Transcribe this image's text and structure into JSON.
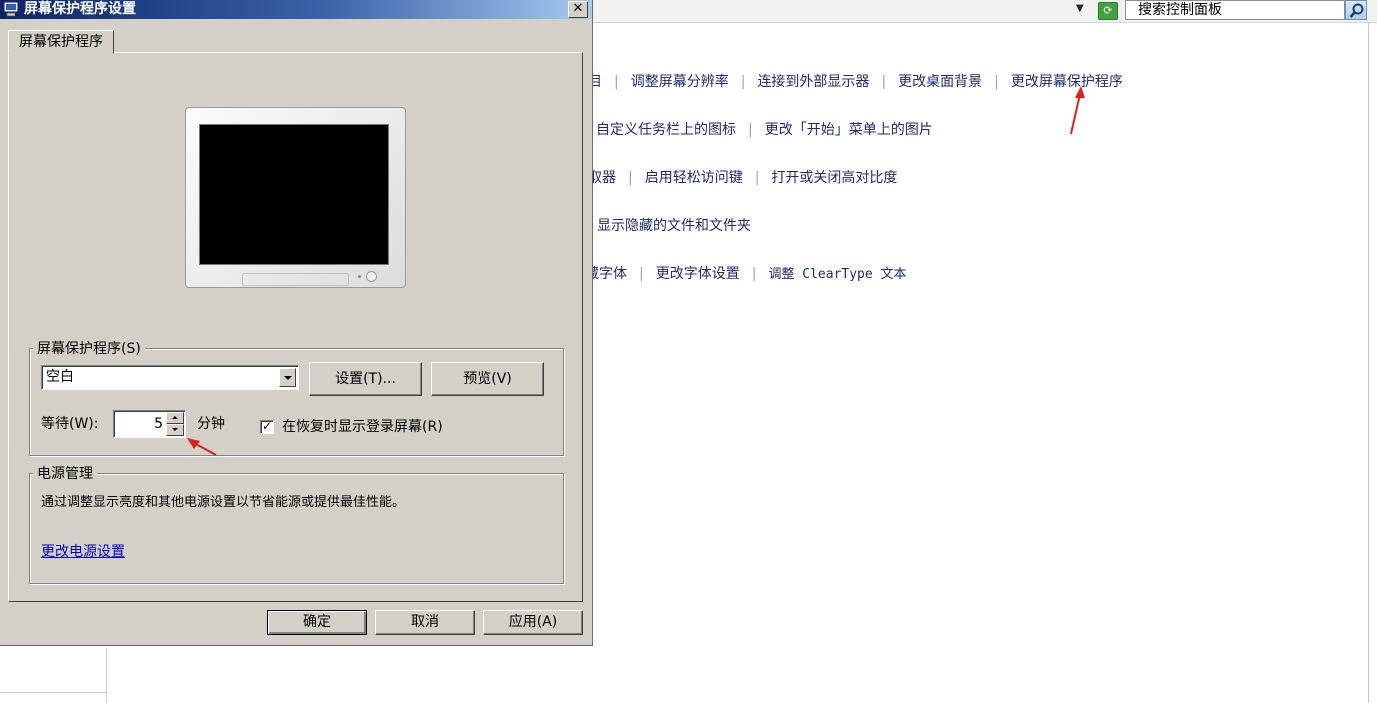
{
  "control_panel": {
    "search_placeholder": "搜索控制面板",
    "rows": [
      [
        "项目",
        "调整屏幕分辨率",
        "连接到外部显示器",
        "更改桌面背景",
        "更改屏幕保护程序"
      ],
      [
        "自定义任务栏上的图标",
        "更改「开始」菜单上的图片"
      ],
      [
        "读取器",
        "启用轻松访问键",
        "打开或关闭高对比度"
      ],
      [
        "显示隐藏的文件和文件夹"
      ],
      [
        "隐藏字体",
        "更改字体设置",
        "调整 ClearType 文本"
      ]
    ],
    "row_prefix_cutoff": [
      "项目",
      "",
      "读取器",
      "",
      "隐藏字体"
    ]
  },
  "dialog": {
    "title": "屏幕保护程序设置",
    "close_label": "✕",
    "tab_label": "屏幕保护程序",
    "screensaver": {
      "group_label": "屏幕保护程序(S)",
      "selected": "空白",
      "settings_label": "设置(T)...",
      "preview_label": "预览(V)",
      "wait_label": "等待(W):",
      "wait_value": "5",
      "minutes_label": "分钟",
      "resume_checked": true,
      "resume_label": "在恢复时显示登录屏幕(R)"
    },
    "power": {
      "group_label": "电源管理",
      "description": "通过调整显示亮度和其他电源设置以节省能源或提供最佳性能。",
      "link_label": "更改电源设置"
    },
    "buttons": {
      "ok": "确定",
      "cancel": "取消",
      "apply": "应用(A)"
    }
  },
  "annotation_color": "#e02020"
}
